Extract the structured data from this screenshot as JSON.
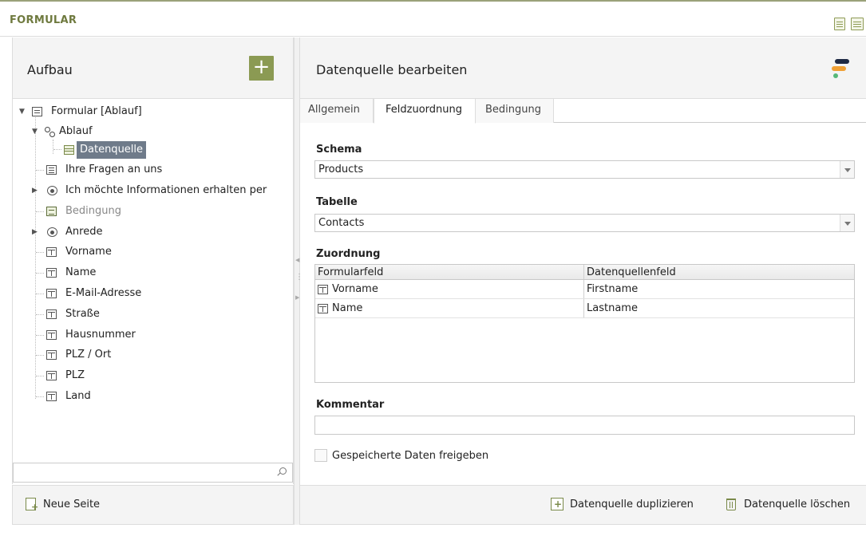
{
  "app": {
    "title": "FORMULAR"
  },
  "left": {
    "title": "Aufbau",
    "add_label": "+",
    "tree": [
      {
        "label": "Formular [Ablauf]",
        "icon": "form-icon"
      },
      {
        "label": "Ablauf",
        "icon": "flow-icon"
      },
      {
        "label": "Datenquelle",
        "icon": "table-icon"
      },
      {
        "label": "Ihre Fragen an uns",
        "icon": "textarea-icon"
      },
      {
        "label": "Ich möchte Informationen erhalten per",
        "icon": "radio-icon"
      },
      {
        "label": "Bedingung",
        "icon": "condition-icon"
      },
      {
        "label": "Anrede",
        "icon": "radio-icon"
      },
      {
        "label": "Vorname",
        "icon": "textfield-icon"
      },
      {
        "label": "Name",
        "icon": "textfield-icon"
      },
      {
        "label": "E-Mail-Adresse",
        "icon": "textfield-icon"
      },
      {
        "label": "Straße",
        "icon": "textfield-icon"
      },
      {
        "label": "Hausnummer",
        "icon": "textfield-icon"
      },
      {
        "label": "PLZ / Ort",
        "icon": "textfield-icon"
      },
      {
        "label": "PLZ",
        "icon": "textfield-icon"
      },
      {
        "label": "Land",
        "icon": "textfield-icon"
      }
    ],
    "search": {
      "value": "",
      "placeholder": ""
    },
    "footer": {
      "new_page_label": "Neue Seite"
    }
  },
  "right": {
    "title": "Datenquelle bearbeiten",
    "tabs": [
      {
        "label": "Allgemein"
      },
      {
        "label": "Feldzuordnung"
      },
      {
        "label": "Bedingung"
      }
    ],
    "schema": {
      "label": "Schema",
      "value": "Products"
    },
    "table": {
      "label": "Tabelle",
      "value": "Contacts"
    },
    "mapping": {
      "label": "Zuordnung",
      "columns": [
        "Formularfeld",
        "Datenquellenfeld"
      ],
      "rows": [
        {
          "form_field": "Vorname",
          "source_field": "Firstname"
        },
        {
          "form_field": "Name",
          "source_field": "Lastname"
        }
      ]
    },
    "comment": {
      "label": "Kommentar",
      "value": ""
    },
    "share": {
      "label": "Gespeicherte Daten freigeben",
      "checked": false
    },
    "footer": {
      "duplicate_label": "Datenquelle duplizieren",
      "delete_label": "Datenquelle löschen"
    }
  },
  "colors": {
    "accent": "#8b9a53",
    "title": "#6f7a3f",
    "selection": "#6f7b8a",
    "brand_dark": "#1f2a44",
    "brand_orange": "#f0a035",
    "brand_green": "#56b878"
  }
}
